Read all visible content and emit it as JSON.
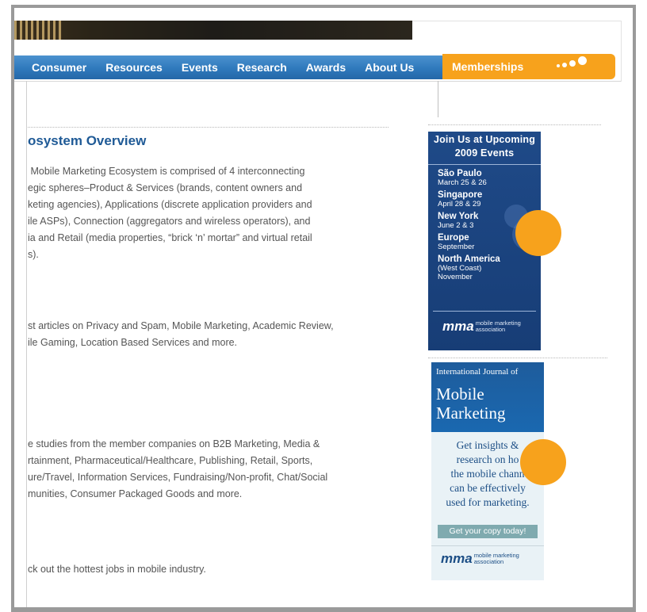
{
  "nav": {
    "items": [
      {
        "label": "Consumer"
      },
      {
        "label": "Resources"
      },
      {
        "label": "Events"
      },
      {
        "label": "Research"
      },
      {
        "label": "Awards"
      },
      {
        "label": "About Us"
      }
    ],
    "membership": "Memberships"
  },
  "content": {
    "title": "osystem Overview",
    "ecosystem_text": " Mobile Marketing Ecosystem is comprised of 4 interconnecting\negic spheres–Product & Services (brands, content owners and\nketing agencies), Applications (discrete application providers and\nile ASPs), Connection (aggregators and wireless operators), and\nia and Retail (media properties, “brick ‘n’ mortar” and virtual retail\ns).",
    "research_text": "st articles on Privacy and Spam, Mobile Marketing, Academic Review,\nile Gaming, Location Based Services and more.",
    "case_text": "e studies from the member companies on B2B Marketing, Media &\nrtainment, Pharmaceutical/Healthcare, Publishing, Retail, Sports,\nure/Travel, Information Services, Fundraising/Non-profit, Chat/Social\nmunities, Consumer Packaged Goods and more.",
    "jobs_text": "ck out the hottest jobs in mobile industry."
  },
  "ad_events": {
    "heading_line1": "Join Us at Upcoming",
    "heading_line2": "2009 Events",
    "events": [
      {
        "city": "São Paulo",
        "date": "March 25 & 26"
      },
      {
        "city": "Singapore",
        "date": "April 28 & 29"
      },
      {
        "city": "New York",
        "date": "June 2 & 3"
      },
      {
        "city": "Europe",
        "date": "September"
      },
      {
        "city": "North America",
        "date": "(West Coast)",
        "date2": "November"
      }
    ],
    "logo": "mma",
    "logo_sub": "mobile marketing association"
  },
  "ad_journal": {
    "small": "International Journal of",
    "big1": "Mobile",
    "big2": "Marketing",
    "body1": "Get insights &",
    "body2": "research on ho",
    "body3": "the mobile chann",
    "body4": "can be effectively",
    "body5": "used for marketing.",
    "cta": "Get your copy today!",
    "logo": "mma",
    "logo_sub": "mobile marketing association"
  },
  "colors": {
    "nav_blue": "#2f79bc",
    "membership_orange": "#f7a21c",
    "title_blue": "#1f5a96",
    "marker_orange": "#f7a21c"
  }
}
